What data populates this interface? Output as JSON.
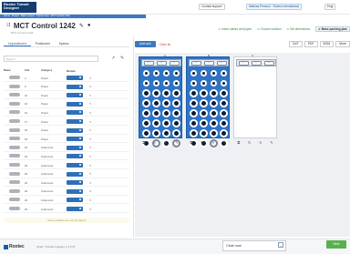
{
  "header": {
    "logo_text": "Roxtec Transit Designer",
    "contact_support": "Contact support",
    "account": "Mathias Persson · Roxtec International",
    "flag": "Engl"
  },
  "breadcrumb": [
    "Home",
    "Project",
    "Basic project",
    "Transit view",
    "MCT Control 1242"
  ],
  "title": {
    "name": "MCT Control 1242",
    "subtitle": "MCT Control 1242"
  },
  "toggles": [
    {
      "label": "Insert cables and pipes",
      "active": false
    },
    {
      "label": "Choose solution",
      "active": false
    },
    {
      "label": "Set dimensions",
      "active": false
    },
    {
      "label": "Make packing plan",
      "active": true
    }
  ],
  "left_tabs": [
    "Unpositioned",
    "Positioned",
    "Spares"
  ],
  "search_placeholder": "Search",
  "table_head": [
    "Name",
    "Cell",
    "Category",
    "Module"
  ],
  "rows": [
    {
      "cell": "2",
      "category": "Power"
    },
    {
      "cell": "6",
      "category": "Power"
    },
    {
      "cell": "10",
      "category": "Power"
    },
    {
      "cell": "10",
      "category": "Power"
    },
    {
      "cell": "16",
      "category": "Power"
    },
    {
      "cell": "17",
      "category": "Power"
    },
    {
      "cell": "18",
      "category": "Power"
    },
    {
      "cell": "18",
      "category": "Power"
    },
    {
      "cell": "20",
      "category": "Instrument"
    },
    {
      "cell": "20",
      "category": "Instrument"
    },
    {
      "cell": "20",
      "category": "Instrument"
    },
    {
      "cell": "20",
      "category": "Instrument"
    },
    {
      "cell": "20",
      "category": "Instrument"
    },
    {
      "cell": "20",
      "category": "Instrument"
    },
    {
      "cell": "20",
      "category": "Instrument"
    },
    {
      "cell": "20",
      "category": "Instrument"
    }
  ],
  "footer_note": "Some modules are not yet placed",
  "toolbar": {
    "add_rack": "Add rack",
    "clear_all": "Clear all",
    "exports": [
      "DXF",
      "PDF",
      "BOM",
      "More"
    ]
  },
  "racks": [
    {
      "label": "A"
    },
    {
      "label": "B"
    },
    {
      "label": "C"
    }
  ],
  "bottom": {
    "brand": "Roxtec",
    "order": "Order: Trondel Imagine 1-4 5 07"
  },
  "chat": "Chat now",
  "next_button": "Next"
}
